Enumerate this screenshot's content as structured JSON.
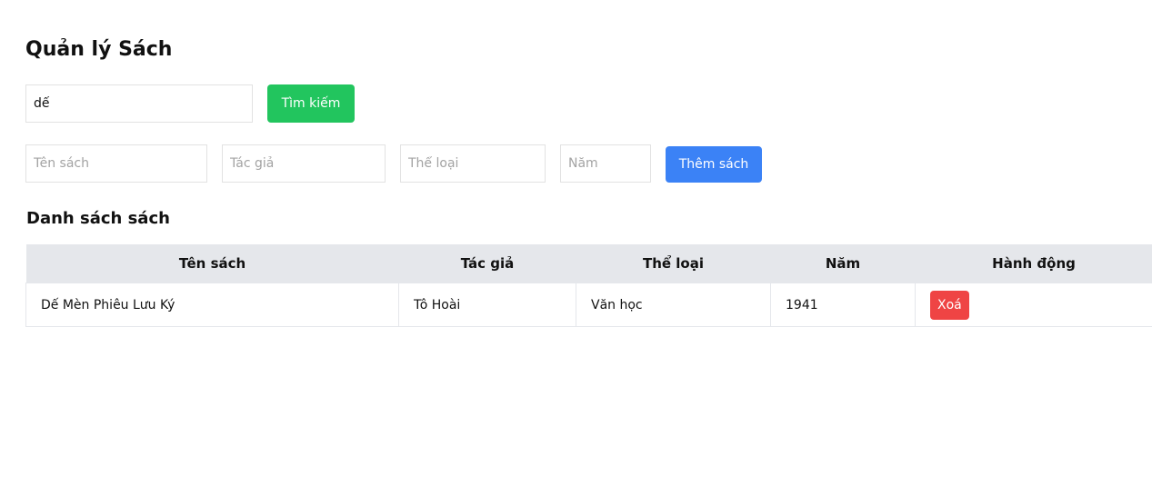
{
  "page": {
    "title": "Quản lý Sách"
  },
  "search": {
    "value": "dế",
    "button_label": "Tìm kiếm"
  },
  "add_form": {
    "title_placeholder": "Tên sách",
    "author_placeholder": "Tác giả",
    "genre_placeholder": "Thể loại",
    "year_placeholder": "Năm",
    "add_button_label": "Thêm sách"
  },
  "list": {
    "title": "Danh sách sách",
    "columns": [
      "Tên sách",
      "Tác giả",
      "Thể loại",
      "Năm",
      "Hành động"
    ],
    "rows": [
      {
        "title": "Dế Mèn Phiêu Lưu Ký",
        "author": "Tô Hoài",
        "genre": "Văn học",
        "year": "1941",
        "action_label": "Xoá"
      }
    ]
  },
  "colors": {
    "search_button": "#22c55e",
    "add_button": "#3b82f6",
    "delete_button": "#ef4444",
    "table_header": "#e5e7eb"
  }
}
